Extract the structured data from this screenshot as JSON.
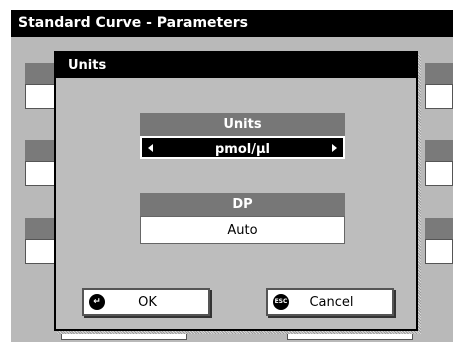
{
  "window": {
    "title": "Standard Curve - Parameters"
  },
  "dialog": {
    "title": "Units",
    "units": {
      "label": "Units",
      "value": "pmol/µl"
    },
    "dp": {
      "label": "DP",
      "value": "Auto"
    },
    "ok_button": {
      "label": "OK",
      "icon": "enter-icon"
    },
    "cancel_button": {
      "label": "Cancel",
      "icon": "esc-icon",
      "icon_text": "ESC"
    }
  }
}
